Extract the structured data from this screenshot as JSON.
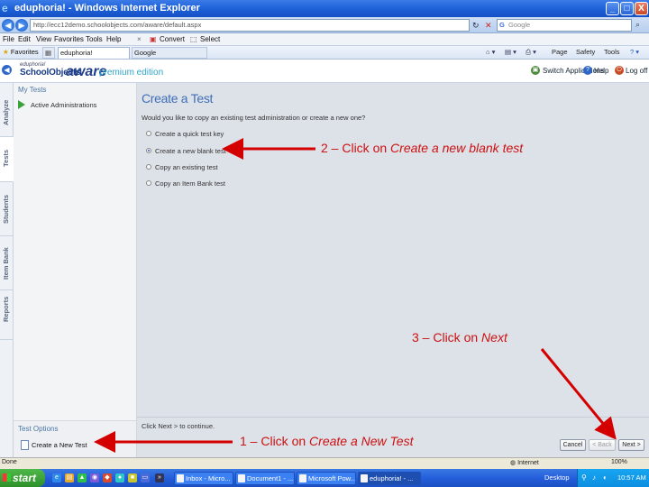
{
  "window": {
    "title": "eduphoria! - Windows Internet Explorer",
    "controls": [
      "_",
      "□",
      "X"
    ]
  },
  "address": {
    "url": "http://ecc12demo.schoolobjects.com/aware/default.aspx",
    "search_placeholder": "Google"
  },
  "menu": {
    "items": [
      "File",
      "Edit",
      "View",
      "Favorites",
      "Tools",
      "Help"
    ],
    "convert": "Convert",
    "select": "Select"
  },
  "favorites": {
    "label": "Favorites",
    "tabs": [
      "eduphoria!",
      "Google"
    ]
  },
  "toolbar_right": {
    "page": "Page",
    "safety": "Safety",
    "tools": "Tools"
  },
  "app": {
    "logo_small": "eduphoria!",
    "logo_main": "SchoolObjects",
    "logo_aware": "aware",
    "logo_edition": "premium edition",
    "switch_applications": "Switch Applications",
    "help": "Help",
    "logoff": "Log off"
  },
  "vertical_tabs": [
    "Analyze",
    "Tests",
    "Students",
    "Item Bank",
    "Reports"
  ],
  "sidebar": {
    "heading": "My Tests",
    "item": "Active Administrations",
    "options_heading": "Test Options",
    "create_new_test": "Create a New Test"
  },
  "main": {
    "title": "Create a Test",
    "question": "Would you like to copy an existing test administration or create a new one?",
    "options": [
      {
        "label": "Create a quick test key",
        "selected": false
      },
      {
        "label": "Create a new blank test",
        "selected": true
      },
      {
        "label": "Copy an existing test",
        "selected": false
      },
      {
        "label": "Copy an Item Bank test",
        "selected": false
      }
    ],
    "click_next": "Click Next > to continue.",
    "buttons": {
      "cancel": "Cancel",
      "back": "< Back",
      "next": "Next >"
    }
  },
  "annotations": {
    "a2_prefix": "2 – Click on ",
    "a2_em": "Create a new blank test",
    "a3_prefix": "3 – Click on ",
    "a3_em": "Next",
    "a1_prefix": "1 – Click on ",
    "a1_em": "Create a New Test",
    "color": "#cc1111"
  },
  "status": {
    "left": "Done",
    "zone": "Internet",
    "zoom": "100%"
  },
  "taskbar": {
    "start": "start",
    "tasks": [
      "Inbox - Micro...",
      "Document1 - ...",
      "Microsoft Pow...",
      "eduphoria! - ..."
    ],
    "desktop": "Desktop",
    "clock": "10:57 AM"
  }
}
